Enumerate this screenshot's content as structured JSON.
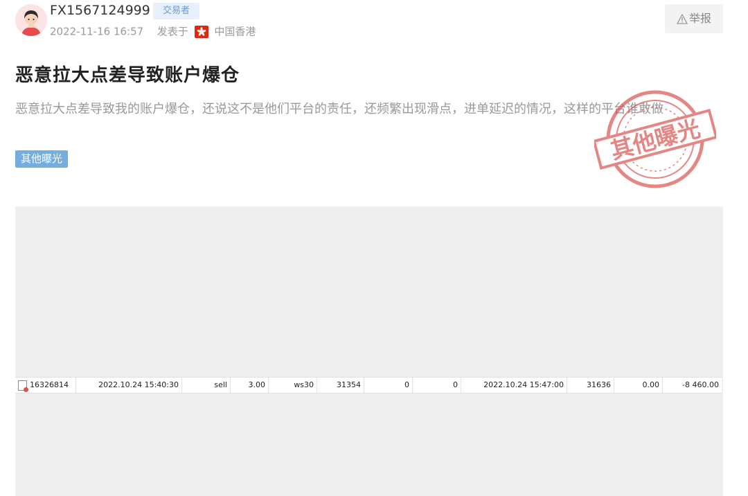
{
  "post": {
    "username": "FX1567124999",
    "role": "交易者",
    "datetime": "2022-11-16 16:57",
    "posted_at_label": "发表于",
    "location": "中国香港",
    "report_label": "举报",
    "title": "恶意拉大点差导致账户爆仓",
    "content": "恶意拉大点差导致我的账户爆仓，还说这不是他们平台的责任，还频繁出现滑点，进单延迟的情况，这样的平台谁敢做",
    "tag": "其他曝光",
    "stamp_text": "其他曝光"
  },
  "trade": {
    "ticket": "16326814",
    "open_time": "2022.10.24 15:40:30",
    "type": "sell",
    "size": "3.00",
    "symbol": "ws30",
    "open_price": "31354",
    "sl": "0",
    "tp": "0",
    "close_time": "2022.10.24 15:47:00",
    "close_price": "31636",
    "commission": "0.00",
    "profit": "-8 460.00"
  },
  "colors": {
    "tag_bg": "#74aee0",
    "badge_bg": "#e8f1fb",
    "badge_text": "#6b9bd0",
    "stamp": "#d9534f",
    "flag": "#de2910"
  }
}
